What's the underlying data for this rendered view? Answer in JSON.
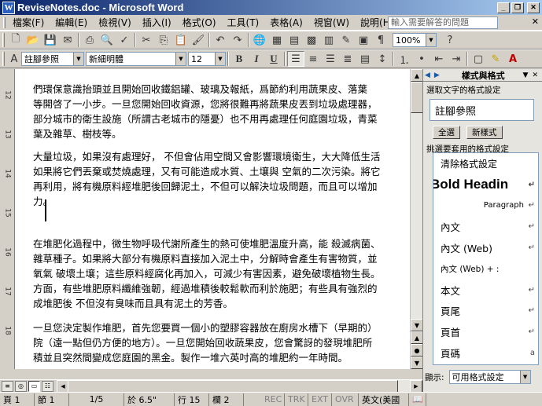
{
  "window": {
    "title": "ReviseNotes.doc - Microsoft Word"
  },
  "menu": {
    "items": [
      "檔案(F)",
      "編輯(E)",
      "檢視(V)",
      "插入(I)",
      "格式(O)",
      "工具(T)",
      "表格(A)",
      "視窗(W)",
      "說明(H)"
    ],
    "help_placeholder": "輸入需要解答的問題"
  },
  "toolbar": {
    "zoom": "100%"
  },
  "format_bar": {
    "style": "註腳參照",
    "font": "新細明體",
    "size": "12"
  },
  "document": {
    "paragraphs": [
      {
        "lines": [
          "們環保意識抬頭並且開始回收鐵鋁罐、玻璃及報紙，爲節約利用蔬果皮、落葉",
          "等開啓了一小步。一旦您開始回收資源，您將很難再將蔬果皮丟到垃圾處理器，",
          "部分城市的衛生設施（所謂古老城市的隱憂）也不用再處理任何庭園垃圾，青菜",
          "葉及雜草、樹枝等。"
        ]
      },
      {
        "lines": [
          "大量垃圾，如果沒有處理好， 不但會佔用空間又會影響環境衛生，大大降低生活",
          "如果將它們丟棄或焚燒處理，又有可能造成水質、土壤與 空氣的二次污染。將它",
          "再利用，將有機原料經堆肥後回歸泥土，不但可以解決垃圾問題，而且可以增加",
          "力。"
        ]
      },
      {
        "lines": [
          "在堆肥化過程中，微生物呼吸代謝所產生的熱可使堆肥溫度升高，能 殺滅病菌、",
          "雜草種子。如果將大部分有機原料直接加入泥土中，分解時會產生有害物質，並",
          "氧氣 破壞土壤；這些原料經腐化再加入，可減少有害因素，避免破壞植物生長。",
          "方面，有些堆肥原料纖維強韌，經過堆積後較鬆軟而利於施肥；有些具有強烈的",
          "成堆肥後 不但沒有臭味而且具有泥土的芳香。"
        ]
      },
      {
        "lines": [
          "一旦您決定製作堆肥，首先您要買一個小的塑膠容器放在廚房水槽下（早期的）",
          "院（遠一點但仍方便的地方）。一旦您開始回收蔬果皮，您會驚訝的發現堆肥所",
          "積並且突然間變成您庭園的黑金。製作一堆六英吋高的堆肥約一年時間。"
        ]
      }
    ]
  },
  "taskpane": {
    "title": "樣式與格式",
    "selected_label": "選取文字的格式設定",
    "selected_style": "註腳參照",
    "select_all": "全選",
    "new_style": "新樣式",
    "apply_label": "挑選要套用的格式設定",
    "styles": [
      {
        "name": "清除格式設定",
        "mark": ""
      },
      {
        "name": "Bold Headin",
        "mark": "↵"
      },
      {
        "name": "Paragraph",
        "mark": "↵"
      },
      {
        "name": "內文",
        "mark": "↵"
      },
      {
        "name": "內文 (Web)",
        "mark": "↵"
      },
      {
        "name": "內文 (Web) + :",
        "mark": ""
      },
      {
        "name": "本文",
        "mark": "↵"
      },
      {
        "name": "頁尾",
        "mark": "↵"
      },
      {
        "name": "頁首",
        "mark": "↵"
      },
      {
        "name": "頁碼",
        "mark": "a"
      }
    ],
    "show_label": "顯示:",
    "show_value": "可用格式設定"
  },
  "status": {
    "page": "頁 1",
    "section": "節 1",
    "pages": "1/5",
    "at": "於 6.5\"",
    "line": "行 15",
    "col": "欄 2",
    "rec": "REC",
    "trk": "TRK",
    "ext": "EXT",
    "ovr": "OVR",
    "lang": "英文(美國"
  }
}
